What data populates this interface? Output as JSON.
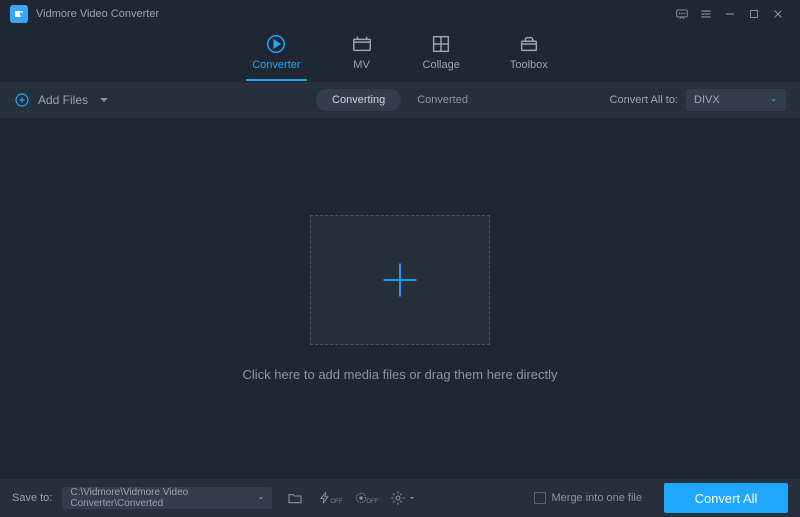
{
  "app": {
    "title": "Vidmore Video Converter"
  },
  "tabs": {
    "converter": "Converter",
    "mv": "MV",
    "collage": "Collage",
    "toolbox": "Toolbox"
  },
  "toolbar": {
    "add_files": "Add Files",
    "converting": "Converting",
    "converted": "Converted",
    "convert_all_to": "Convert All to:",
    "selected_format": "DIVX"
  },
  "drop": {
    "hint": "Click here to add media files or drag them here directly"
  },
  "bottombar": {
    "save_to_label": "Save to:",
    "save_path": "C:\\Vidmore\\Vidmore Video Converter\\Converted",
    "off1": "OFF",
    "off2": "OFF",
    "merge_label": "Merge into one file",
    "convert_all": "Convert All"
  }
}
